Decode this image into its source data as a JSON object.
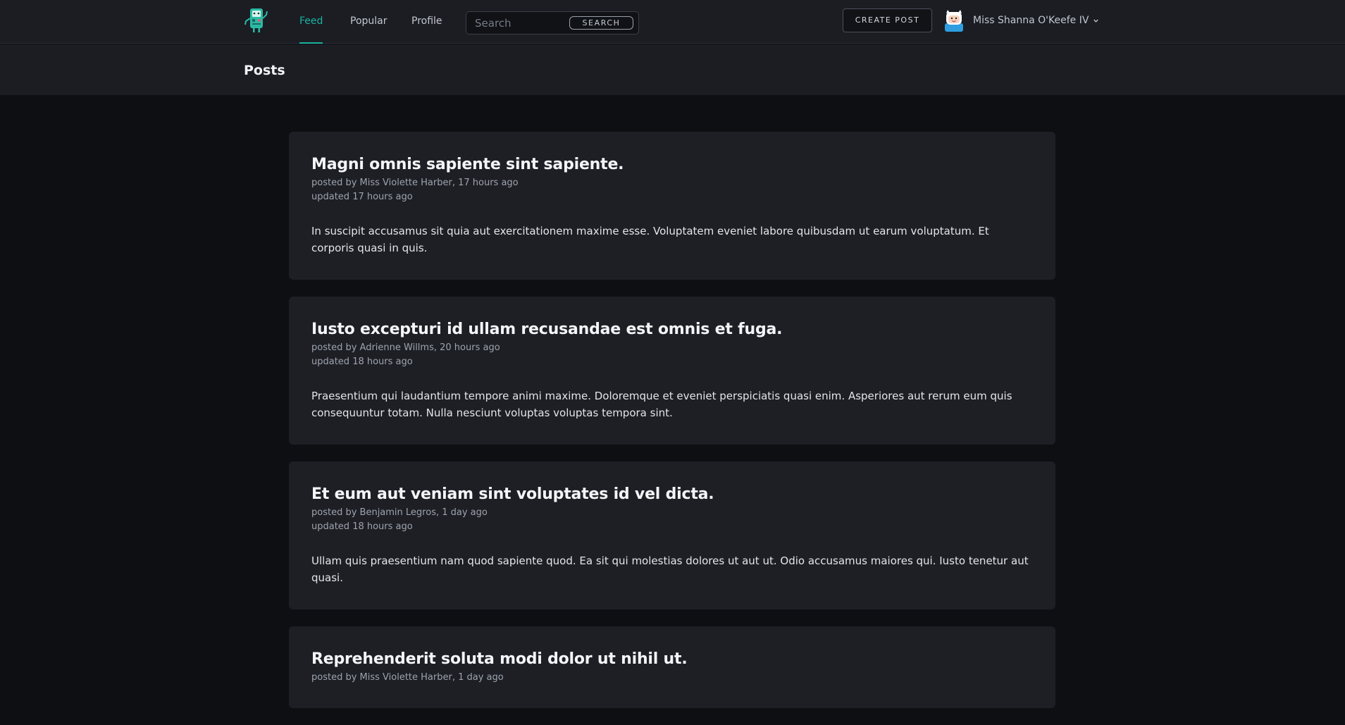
{
  "nav": {
    "items": [
      {
        "label": "Feed",
        "active": true
      },
      {
        "label": "Popular",
        "active": false
      },
      {
        "label": "Profile",
        "active": false
      }
    ],
    "search": {
      "placeholder": "Search",
      "value": "",
      "button_label": "SEARCH"
    },
    "create_post_label": "CREATE POST",
    "user": {
      "name": "Miss Shanna O'Keefe IV",
      "avatar_icon": "avatar-icon"
    },
    "accent_color": "#1bb3a0"
  },
  "page": {
    "title": "Posts"
  },
  "posts": [
    {
      "title": "Magni omnis sapiente sint sapiente.",
      "posted": "posted by Miss Violette Harber, 17 hours ago",
      "updated": "updated 17 hours ago",
      "body": "In suscipit accusamus sit quia aut exercitationem maxime esse. Voluptatem eveniet labore quibusdam ut earum voluptatum. Et corporis quasi in quis."
    },
    {
      "title": "Iusto excepturi id ullam recusandae est omnis et fuga.",
      "posted": "posted by Adrienne Willms, 20 hours ago",
      "updated": "updated 18 hours ago",
      "body": "Praesentium qui laudantium tempore animi maxime. Doloremque et eveniet perspiciatis quasi enim. Asperiores aut rerum eum quis consequuntur totam. Nulla nesciunt voluptas voluptas tempora sint."
    },
    {
      "title": "Et eum aut veniam sint voluptates id vel dicta.",
      "posted": "posted by Benjamin Legros, 1 day ago",
      "updated": "updated 18 hours ago",
      "body": "Ullam quis praesentium nam quod sapiente quod. Ea sit qui molestias dolores ut aut ut. Odio accusamus maiores qui. Iusto tenetur aut quasi."
    },
    {
      "title": "Reprehenderit soluta modi dolor ut nihil ut.",
      "posted": "posted by Miss Violette Harber, 1 day ago",
      "updated": "",
      "body": ""
    }
  ]
}
